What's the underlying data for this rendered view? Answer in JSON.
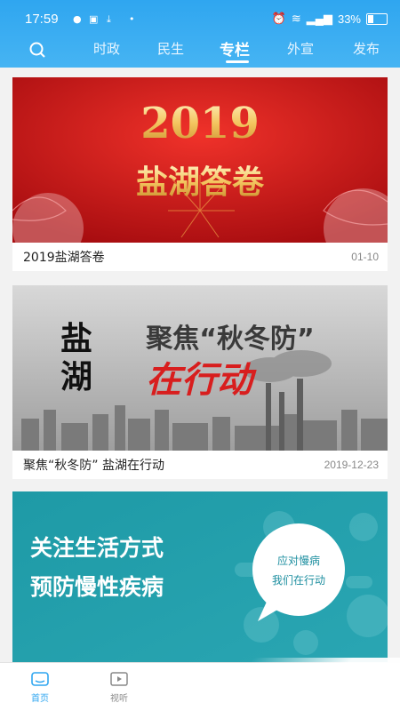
{
  "status": {
    "time": "17:59",
    "battery": "33%"
  },
  "tabs": [
    {
      "label": "时政"
    },
    {
      "label": "民生"
    },
    {
      "label": "专栏"
    },
    {
      "label": "外宣"
    },
    {
      "label": "发布"
    }
  ],
  "active_tab": "专栏",
  "articles": [
    {
      "title": "2019盐湖答卷",
      "date": "01-10",
      "banner": {
        "line1": "2019",
        "line2": "盐湖答卷"
      }
    },
    {
      "title": "聚焦“秋冬防” 盐湖在行动",
      "date": "2019-12-23",
      "banner": {
        "left_top": "盐",
        "left_bottom": "湖",
        "line1": "聚焦“秋冬防”",
        "line2": "在行动"
      }
    },
    {
      "title": "",
      "date": "",
      "banner": {
        "line1": "关注生活方式",
        "line2": "预防慢性疾病",
        "badge1": "应对慢病",
        "badge2": "我们在行动"
      }
    }
  ],
  "bottom_nav": [
    {
      "label": "首页"
    },
    {
      "label": "视听"
    }
  ],
  "colors": {
    "accent": "#2fa6f0",
    "red": "#d81e1e",
    "teal": "#1f9aa6"
  }
}
